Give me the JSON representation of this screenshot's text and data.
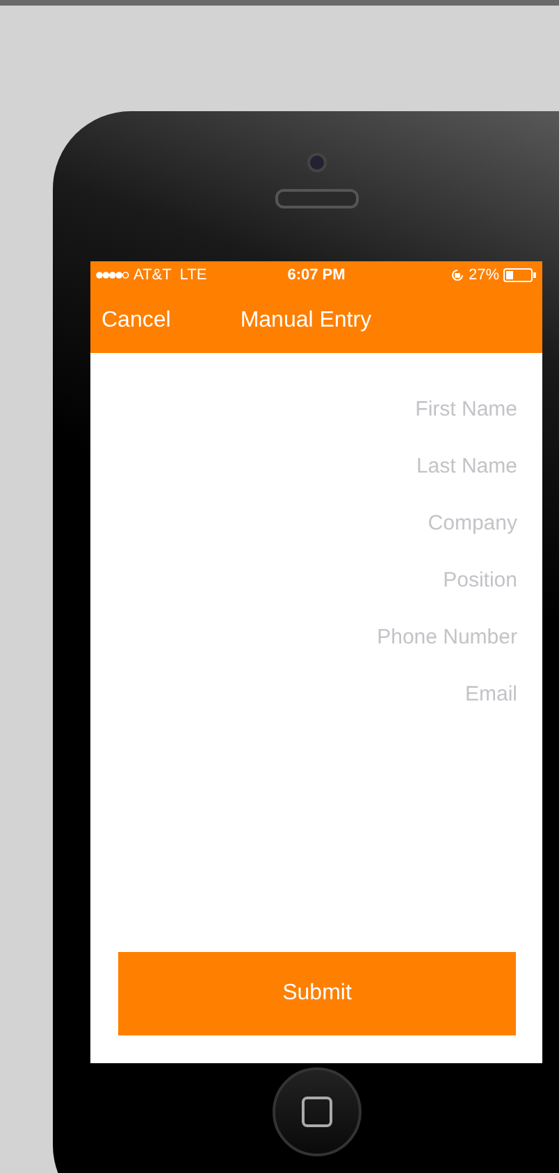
{
  "status_bar": {
    "carrier": "AT&T",
    "network": "LTE",
    "time": "6:07 PM",
    "battery": "27%"
  },
  "nav": {
    "cancel": "Cancel",
    "title": "Manual Entry"
  },
  "fields": [
    {
      "placeholder": "First Name"
    },
    {
      "placeholder": "Last Name"
    },
    {
      "placeholder": "Company"
    },
    {
      "placeholder": "Position"
    },
    {
      "placeholder": "Phone Number"
    },
    {
      "placeholder": "Email"
    }
  ],
  "submit": "Submit"
}
